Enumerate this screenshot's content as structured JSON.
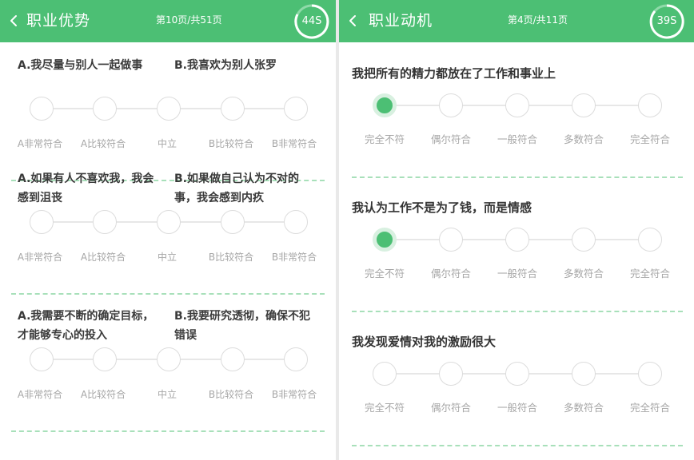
{
  "left": {
    "header": {
      "title": "职业优势",
      "page_info": "第10页/共51页",
      "timer": "44S"
    },
    "scale_labels": [
      "A非常符合",
      "A比较符合",
      "中立",
      "B比较符合",
      "B非常符合"
    ],
    "questions": [
      {
        "a": "A.我尽量与别人一起做事",
        "b": "B.我喜欢为别人张罗",
        "selected": null
      },
      {
        "a": "A.如果有人不喜欢我，我会感到沮丧",
        "b": "B.如果做自己认为不对的事，我会感到内疚",
        "selected": null
      },
      {
        "a": "A.我需要不断的确定目标，才能够专心的投入",
        "b": "B.我要研究透彻，确保不犯错误",
        "selected": null
      }
    ]
  },
  "right": {
    "header": {
      "title": "职业动机",
      "page_info": "第4页/共11页",
      "timer": "39S"
    },
    "scale_labels": [
      "完全不符",
      "偶尔符合",
      "一般符合",
      "多数符合",
      "完全符合"
    ],
    "questions": [
      {
        "text": "我把所有的精力都放在了工作和事业上",
        "selected": 0
      },
      {
        "text": "我认为工作不是为了钱，而是情感",
        "selected": 0
      },
      {
        "text": "我发现爱情对我的激励很大",
        "selected": null
      }
    ]
  },
  "colors": {
    "brand_green": "#4cbf74",
    "divider": "#a8e0ba",
    "label_gray": "#a6a6a6"
  },
  "icons": {
    "back": "chevron-left-icon",
    "timer": "countdown-ring-icon"
  }
}
